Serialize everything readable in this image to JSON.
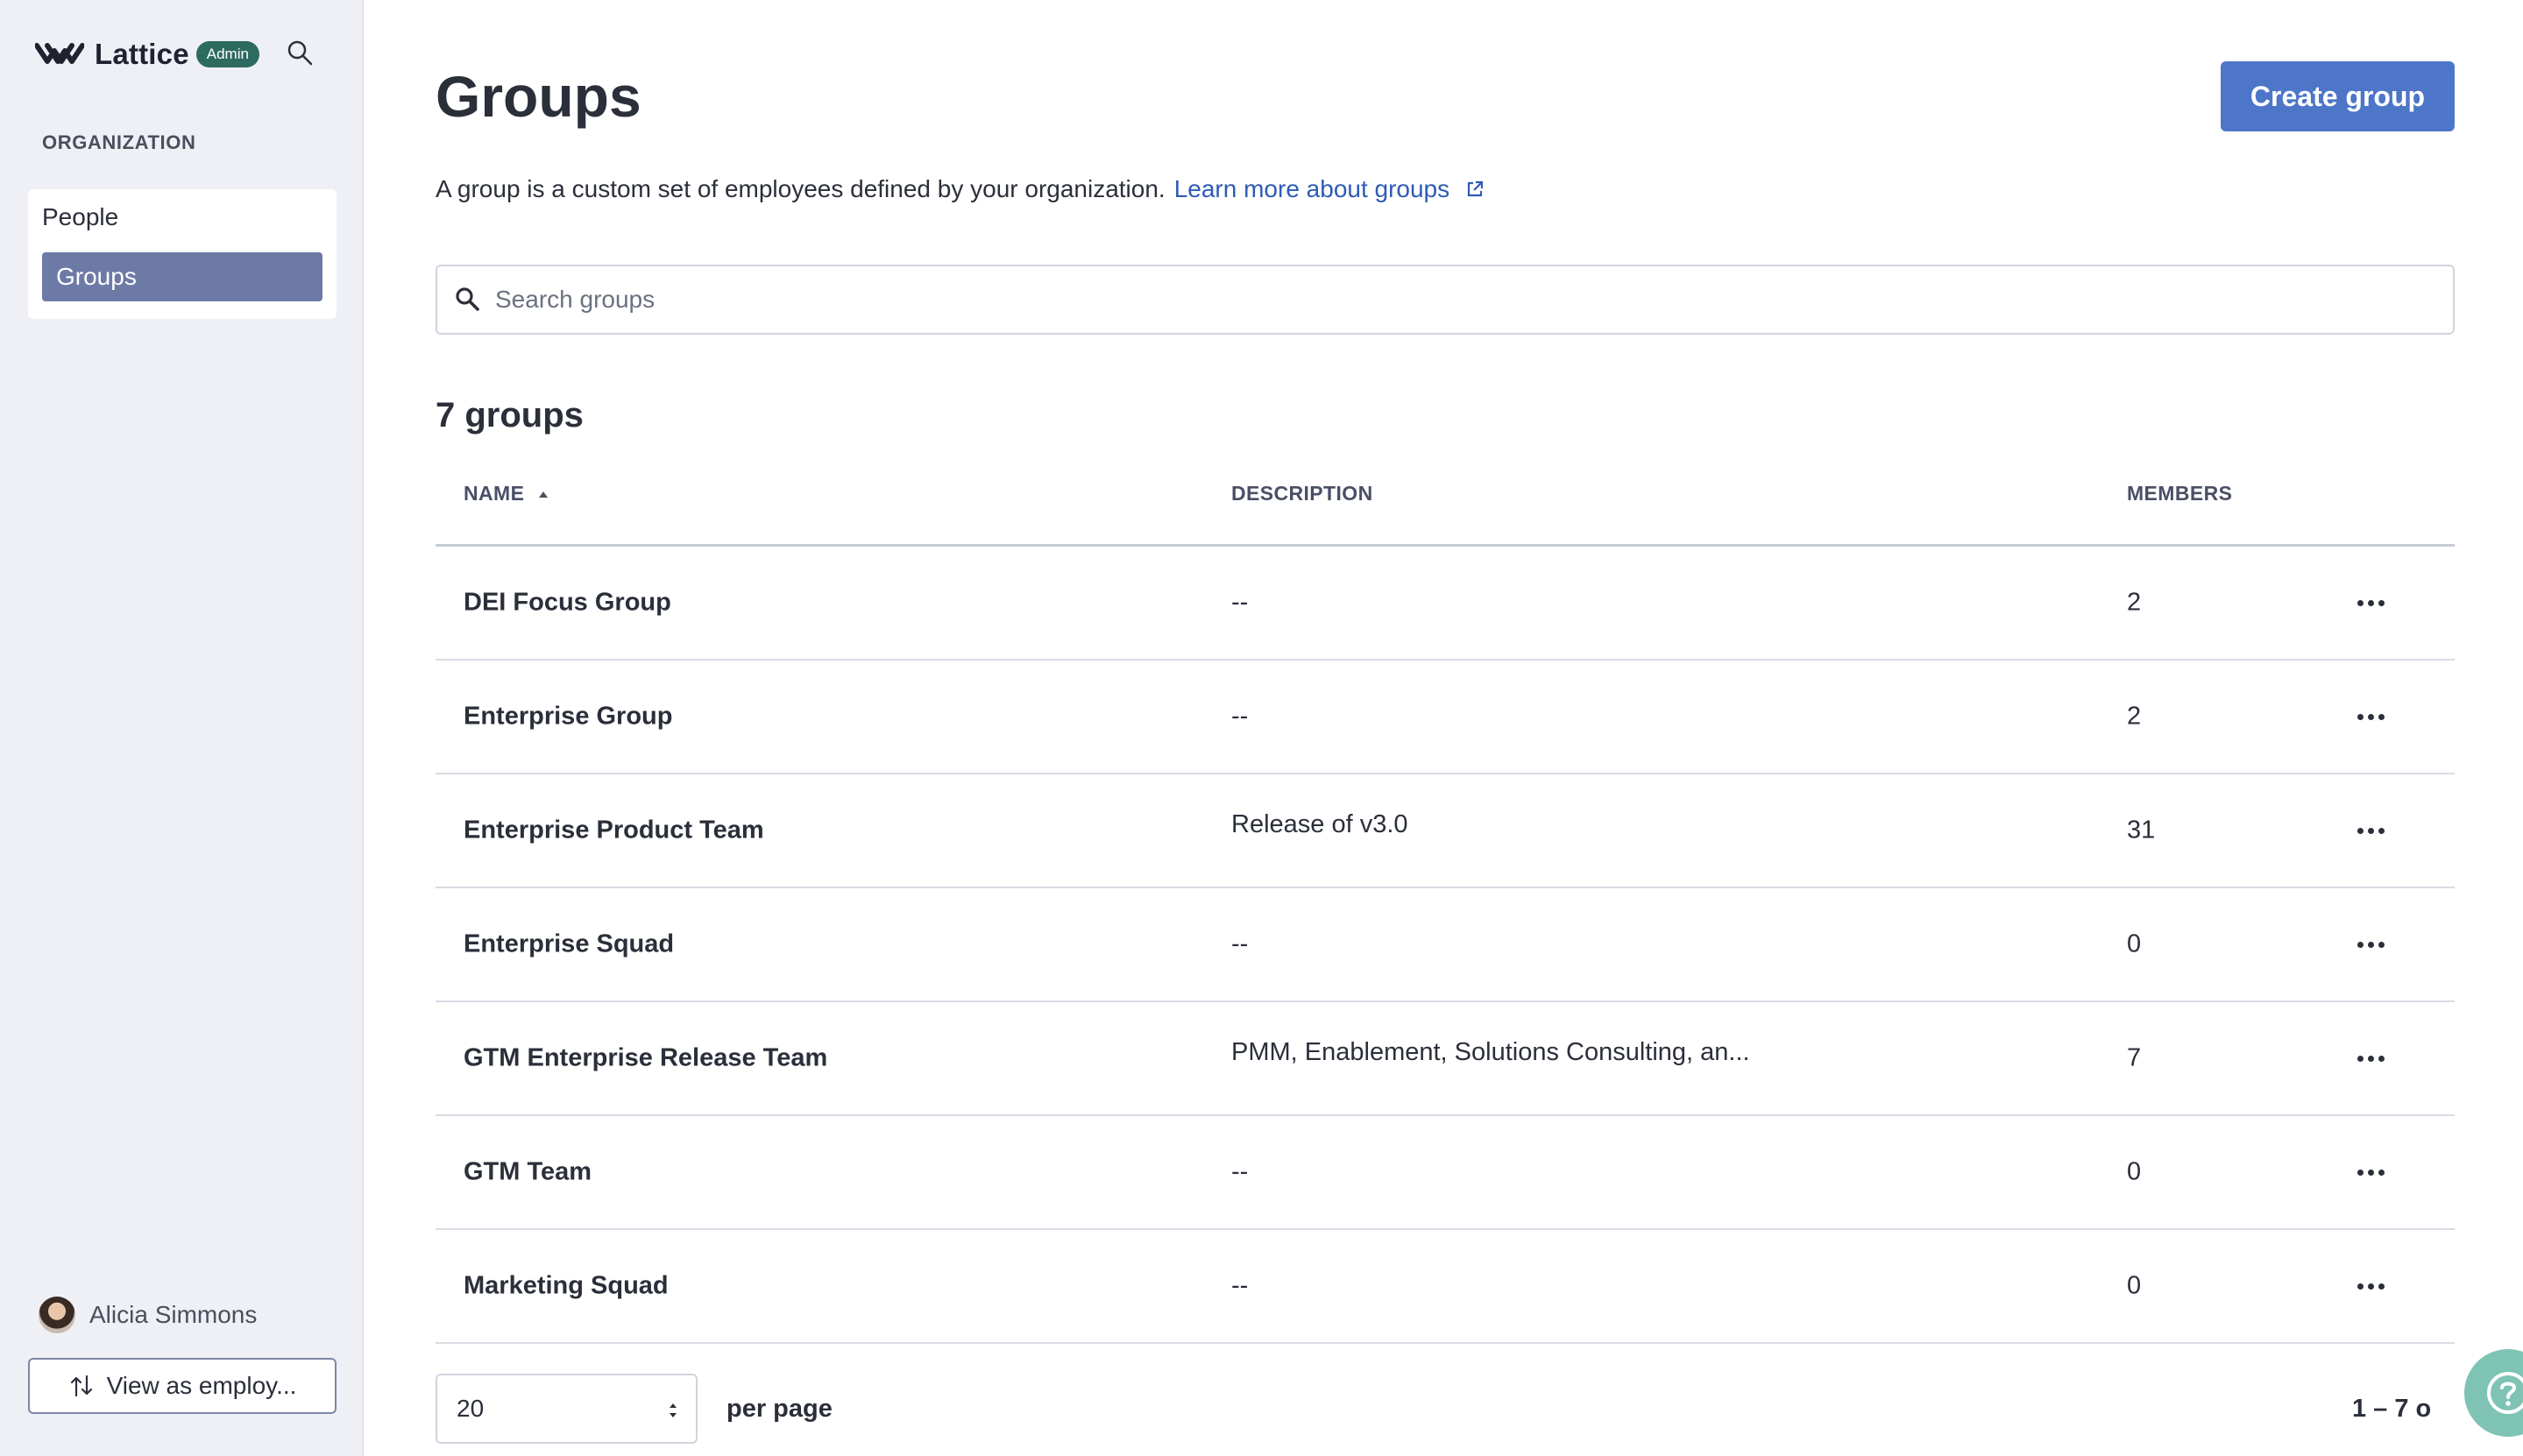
{
  "brand": {
    "name": "Lattice",
    "badge": "Admin"
  },
  "sidebar": {
    "section_label": "ORGANIZATION",
    "items": [
      {
        "label": "People",
        "active": false
      },
      {
        "label": "Groups",
        "active": true
      }
    ],
    "user_name": "Alicia Simmons",
    "view_as_label": "View as employ..."
  },
  "header": {
    "title": "Groups",
    "create_button": "Create group"
  },
  "intro": {
    "text": "A group is a custom set of employees defined by your organization.",
    "link": "Learn more about groups"
  },
  "search": {
    "placeholder": "Search groups",
    "value": ""
  },
  "count_label": "7 groups",
  "table": {
    "columns": {
      "name": "NAME",
      "description": "DESCRIPTION",
      "members": "MEMBERS"
    },
    "rows": [
      {
        "name": "DEI Focus Group",
        "description": "--",
        "members": "2"
      },
      {
        "name": "Enterprise Group",
        "description": "--",
        "members": "2"
      },
      {
        "name": "Enterprise Product Team",
        "description": "Release of v3.0",
        "members": "31"
      },
      {
        "name": "Enterprise Squad",
        "description": "--",
        "members": "0"
      },
      {
        "name": "GTM Enterprise Release Team",
        "description": "PMM, Enablement, Solutions Consulting, an...",
        "members": "7"
      },
      {
        "name": "GTM Team",
        "description": "--",
        "members": "0"
      },
      {
        "name": "Marketing Squad",
        "description": "--",
        "members": "0"
      }
    ]
  },
  "pagination": {
    "per_page_value": "20",
    "per_page_label": "per page",
    "range": "1 – 7 o"
  },
  "colors": {
    "accent": "#4d76c9",
    "sidebar_active": "#6d7aa5",
    "badge": "#2d6a5f",
    "help": "#7ec3b4"
  },
  "icons": {
    "logo": "lattice-logo-icon",
    "search": "search-icon",
    "external": "external-link-icon",
    "sort": "sort-ascending-icon",
    "more": "more-horizontal-icon",
    "swap": "swap-icon",
    "help": "help-icon"
  }
}
